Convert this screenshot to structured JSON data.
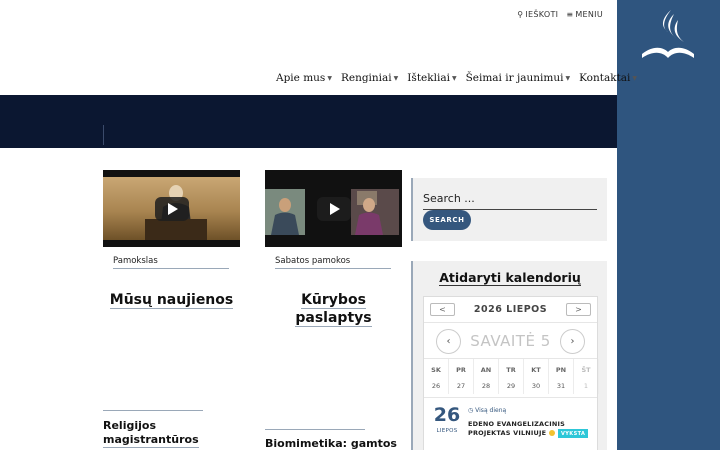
{
  "colors": {
    "brand": "#2f557f",
    "hero": "#0b1731",
    "button": "#35577e",
    "tag": "#2ec7d8"
  },
  "utility": {
    "search_label": "IEŠKOTI",
    "menu_label": "MENIU"
  },
  "nav": [
    {
      "label": "Apie mus"
    },
    {
      "label": "Renginiai"
    },
    {
      "label": "Ištekliai"
    },
    {
      "label": "Šeimai ir jaunimui"
    },
    {
      "label": "Kontaktai"
    }
  ],
  "cards": [
    {
      "category": "Pamokslas",
      "title": "Mūsų naujienos"
    },
    {
      "category": "Sabatos pamokos",
      "title_line1": "Kūrybos",
      "title_line2": "paslaptys"
    }
  ],
  "posts": [
    {
      "line1": "Religijos",
      "line2": "magistrantūros"
    },
    {
      "line1": "Biomimetika: gamtos"
    }
  ],
  "search": {
    "placeholder": "Search ...",
    "button": "SEARCH"
  },
  "calendar": {
    "open_link": "Atidaryti kalendorių",
    "month": "2026 LIEPOS",
    "prev_month": "<",
    "next_month": ">",
    "week": "SAVAITĖ 5",
    "prev_week": "‹",
    "next_week": "›",
    "day_headers": [
      "SK",
      "PR",
      "AN",
      "TR",
      "KT",
      "PN",
      "ŠT"
    ],
    "days": [
      "26",
      "27",
      "28",
      "29",
      "30",
      "31",
      "1"
    ],
    "event": {
      "day": "26",
      "month": "LIEPOS",
      "all_day": "Visą dieną",
      "title": "EDENO EVANGELIZACINIS PROJEKTAS VILNIUJE",
      "tag": "VYKSTA"
    }
  }
}
